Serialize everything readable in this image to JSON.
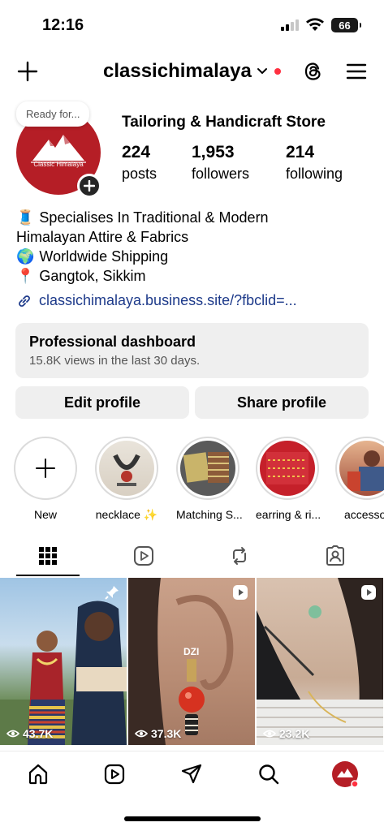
{
  "status_bar": {
    "time": "12:16",
    "battery": "66"
  },
  "header": {
    "username": "classichimalaya"
  },
  "profile": {
    "note": "Ready for...",
    "avatar_text": "Classic Himalaya",
    "category": "Tailoring & Handicraft Store",
    "stats": [
      {
        "value": "224",
        "label": "posts"
      },
      {
        "value": "1,953",
        "label": "followers"
      },
      {
        "value": "214",
        "label": "following"
      }
    ],
    "bio": [
      {
        "emoji": "🧵",
        "text": "Specialises In Traditional & Modern"
      },
      {
        "emoji": "",
        "text": "Himalayan Attire & Fabrics"
      },
      {
        "emoji": "🌍",
        "text": "Worldwide Shipping"
      },
      {
        "emoji": "📍",
        "text": "Gangtok, Sikkim"
      }
    ],
    "link": "classichimalaya.business.site/?fbclid=..."
  },
  "dashboard": {
    "title": "Professional dashboard",
    "subtitle": "15.8K views in the last 30 days."
  },
  "actions": {
    "edit": "Edit profile",
    "share": "Share profile"
  },
  "highlights": [
    {
      "label": "New"
    },
    {
      "label": "necklace ✨"
    },
    {
      "label": "Matching S..."
    },
    {
      "label": "earring & ri..."
    },
    {
      "label": "accessor"
    }
  ],
  "posts": [
    {
      "views": "43.7K",
      "pinned": true
    },
    {
      "views": "37.3K",
      "overlay": "DZI"
    },
    {
      "views": "23.2K"
    }
  ],
  "colors": {
    "brand": "#b51e26",
    "notification": "#ff3040",
    "link": "#1d3a8a"
  }
}
